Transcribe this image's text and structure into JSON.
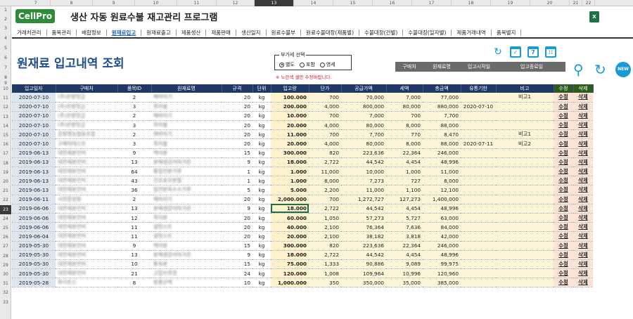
{
  "app": {
    "logo": "CellPro",
    "title": "생산 자동 원료수불 재고관리 프로그램"
  },
  "col_headers": [
    "7",
    "8",
    "9",
    "10",
    "11",
    "12",
    "13",
    "14",
    "15",
    "16",
    "17",
    "18",
    "19",
    "20",
    "21",
    "22"
  ],
  "row_headers": [
    "1",
    "2",
    "3",
    "4",
    "5",
    "6",
    "7",
    "8",
    "9",
    "10",
    "11",
    "12",
    "13",
    "14",
    "15",
    "16",
    "17",
    "18",
    "19",
    "20",
    "21",
    "22",
    "23",
    "24",
    "25",
    "26",
    "27",
    "28",
    "29",
    "30",
    "31",
    "32",
    "33"
  ],
  "menu": [
    "거래처관리",
    "품목관리",
    "배합정보",
    "원재료입고",
    "원재료출고",
    "제품생산",
    "제품판매",
    "생산일지",
    "원료수불부",
    "원료수불대장(제품별)",
    "수불대장(건별)",
    "수불대장(일자별)",
    "제품거래내역",
    "품목별지"
  ],
  "active_menu": 3,
  "page_title": "원재료 입고내역 조회",
  "vat_option": {
    "label": "부가세 선택",
    "options": [
      "별도",
      "포함",
      "영세"
    ],
    "selected": 0
  },
  "note": "※ 노란색 셀만 수정바랍니다.",
  "filter_headers": [
    "구매처",
    "원재료명",
    "입고시작일",
    "입고종료일"
  ],
  "table": {
    "headers": [
      "입고일자",
      "구매처",
      "품목ID",
      "원재료명",
      "규격",
      "단위",
      "입고량",
      "단가",
      "공급가액",
      "세액",
      "총금액",
      "유통기한",
      "비고",
      "수정",
      "삭제"
    ],
    "rows": [
      [
        "2020-07-10",
        "(주)은방맛금",
        "2",
        "해바라기",
        "20",
        "kg",
        "100.000",
        "700",
        "70,000",
        "7,000",
        "77,000",
        "",
        "비고1",
        "수정",
        "삭제"
      ],
      [
        "2020-07-10",
        "(주)은방맛금",
        "3",
        "흑미쌀",
        "20",
        "kg",
        "200.000",
        "4,000",
        "800,000",
        "80,000",
        "880,000",
        "2020-07-10",
        "",
        "수정",
        "삭제"
      ],
      [
        "2020-07-10",
        "(주)은방맛금",
        "2",
        "해바라기",
        "20",
        "kg",
        "10.000",
        "700",
        "7,000",
        "700",
        "7,700",
        "",
        "",
        "수정",
        "삭제"
      ],
      [
        "2020-07-10",
        "(주)은방맛금",
        "3",
        "흑미쌀",
        "20",
        "kg",
        "20.000",
        "4,000",
        "80,000",
        "8,000",
        "88,000",
        "",
        "",
        "수정",
        "삭제"
      ],
      [
        "2020-07-10",
        "강원영농협동조합",
        "2",
        "해바라기",
        "20",
        "kg",
        "11.000",
        "700",
        "7,700",
        "770",
        "8,470",
        "",
        "비고1",
        "수정",
        "삭제"
      ],
      [
        "2020-07-10",
        "구매처테스트",
        "3",
        "흑미쌀",
        "20",
        "kg",
        "20.000",
        "4,000",
        "80,000",
        "8,000",
        "88,000",
        "2020-07-11",
        "비고2",
        "수정",
        "삭제"
      ],
      [
        "2019-06-13",
        "대한제분전비",
        "9",
        "맥아분",
        "15",
        "kg",
        "300.000",
        "820",
        "223,636",
        "22,364",
        "246,000",
        "",
        "",
        "수정",
        "삭제"
      ],
      [
        "2019-06-13",
        "대한제분전비",
        "13",
        "분해생강아마가린",
        "9",
        "kg",
        "18.000",
        "2,722",
        "44,542",
        "4,454",
        "48,996",
        "",
        "",
        "수정",
        "삭제"
      ],
      [
        "2019-06-13",
        "대한제분전비",
        "64",
        "통밀전분가루",
        "1",
        "kg",
        "1.000",
        "11,000",
        "10,000",
        "1,000",
        "11,000",
        "",
        "",
        "수정",
        "삭제"
      ],
      [
        "2019-06-13",
        "대한제분전비",
        "43",
        "건조효모분말",
        "1",
        "kg",
        "1.000",
        "8,000",
        "7,273",
        "727",
        "8,000",
        "",
        "",
        "수정",
        "삭제"
      ],
      [
        "2019-06-13",
        "대한제분전비",
        "36",
        "밀전분옥수수가루",
        "5",
        "kg",
        "5.000",
        "2,200",
        "11,000",
        "1,100",
        "12,100",
        "",
        "",
        "수정",
        "삭제"
      ],
      [
        "2019-06-11",
        "서천흥양원",
        "2",
        "해바라기",
        "20",
        "kg",
        "2,000.000",
        "700",
        "1,272,727",
        "127,273",
        "1,400,000",
        "",
        "",
        "수정",
        "삭제"
      ],
      [
        "2019-06-06",
        "대한제분전비",
        "13",
        "분해생강아마가린",
        "9",
        "kg",
        "18.000",
        "2,722",
        "44,542",
        "4,454",
        "48,996",
        "",
        "",
        "수정",
        "삭제"
      ],
      [
        "2019-06-06",
        "대한제분전비",
        "12",
        "흑미분",
        "20",
        "kg",
        "60.000",
        "1,050",
        "57,273",
        "5,727",
        "63,000",
        "",
        "",
        "수정",
        "삭제"
      ],
      [
        "2019-06-06",
        "대한제분전비",
        "11",
        "설탕스트",
        "20",
        "kg",
        "40.000",
        "2,100",
        "76,364",
        "7,636",
        "84,000",
        "",
        "",
        "수정",
        "삭제"
      ],
      [
        "2019-06-04",
        "대한제분전비",
        "11",
        "설탕스트",
        "20",
        "kg",
        "20.000",
        "2,100",
        "38,182",
        "3,818",
        "42,000",
        "",
        "",
        "수정",
        "삭제"
      ],
      [
        "2019-05-30",
        "대한제분전비",
        "9",
        "맥아분",
        "15",
        "kg",
        "300.000",
        "820",
        "223,636",
        "22,364",
        "246,000",
        "",
        "",
        "수정",
        "삭제"
      ],
      [
        "2019-05-30",
        "대한제분전비",
        "13",
        "분해생강아마가린",
        "9",
        "kg",
        "18.000",
        "2,722",
        "44,542",
        "4,454",
        "48,996",
        "",
        "",
        "수정",
        "삭제"
      ],
      [
        "2019-05-30",
        "대한제분전비",
        "10",
        "통독분",
        "15",
        "kg",
        "75.000",
        "1,333",
        "90,886",
        "9,089",
        "99,975",
        "",
        "",
        "수정",
        "삭제"
      ],
      [
        "2019-05-30",
        "대한제분전비",
        "21",
        "고맙쓰흑엿",
        "24",
        "kg",
        "120.000",
        "1,008",
        "109,964",
        "10,996",
        "120,960",
        "",
        "",
        "수정",
        "삭제"
      ],
      [
        "2019-05-28",
        "화이트드",
        "8",
        "방풍산맥",
        "10",
        "kg",
        "1,000.000",
        "350",
        "350,000",
        "35,000",
        "385,000",
        "",
        "",
        "수정",
        "삭제"
      ]
    ]
  },
  "colors": {
    "header_navy": "#1f3864",
    "accent_blue": "#1a9bd8",
    "title_blue": "#1f4e8c",
    "input_yellow": "#fff2cc"
  },
  "icons": {
    "refresh": "refresh-icon",
    "calendar": "calendar-icon",
    "search": "search-icon",
    "new": "new-badge-icon"
  },
  "new_label": "NEW"
}
